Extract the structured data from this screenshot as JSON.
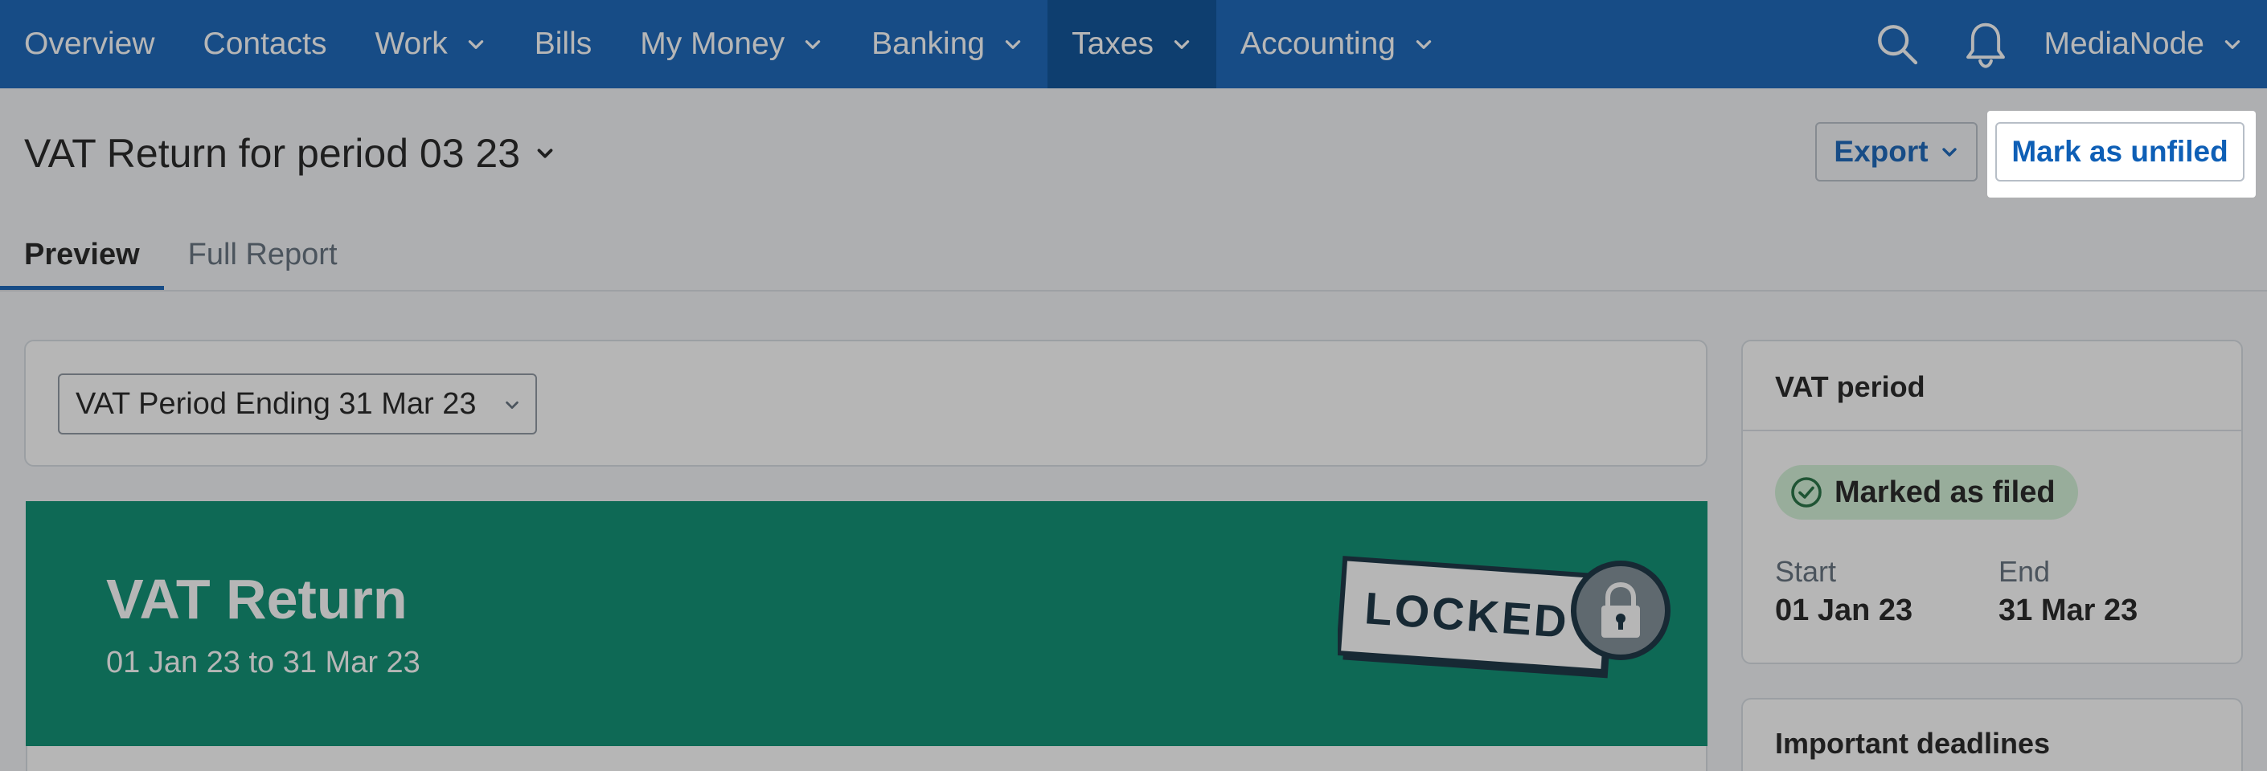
{
  "nav": {
    "items": [
      {
        "label": "Overview",
        "has_dropdown": false,
        "active": false
      },
      {
        "label": "Contacts",
        "has_dropdown": false,
        "active": false
      },
      {
        "label": "Work",
        "has_dropdown": true,
        "active": false
      },
      {
        "label": "Bills",
        "has_dropdown": false,
        "active": false
      },
      {
        "label": "My Money",
        "has_dropdown": true,
        "active": false
      },
      {
        "label": "Banking",
        "has_dropdown": true,
        "active": false
      },
      {
        "label": "Taxes",
        "has_dropdown": true,
        "active": true
      },
      {
        "label": "Accounting",
        "has_dropdown": true,
        "active": false
      }
    ],
    "search_icon": "search-icon",
    "bell_icon": "bell-icon",
    "org_name": "MediaNode"
  },
  "header": {
    "title": "VAT Return for period 03 23",
    "export_label": "Export",
    "unfiled_label": "Mark as unfiled",
    "tabs": [
      {
        "label": "Preview",
        "active": true
      },
      {
        "label": "Full Report",
        "active": false
      }
    ]
  },
  "period_select": {
    "value": "VAT Period Ending 31 Mar 23"
  },
  "banner": {
    "title": "VAT Return",
    "subtitle": "01 Jan 23 to 31 Mar 23",
    "stamp_text": "LOCKED",
    "color": "#008a6d"
  },
  "sidebar": {
    "vat_period_heading": "VAT period",
    "status_badge": "Marked as filed",
    "start_label": "Start",
    "start_value": "01 Jan 23",
    "end_label": "End",
    "end_value": "31 Mar 23",
    "deadlines_heading": "Important deadlines"
  },
  "colors": {
    "brand_blue": "#0e5fb6",
    "active_nav": "#004a94",
    "success_green": "#d2f1d6"
  }
}
